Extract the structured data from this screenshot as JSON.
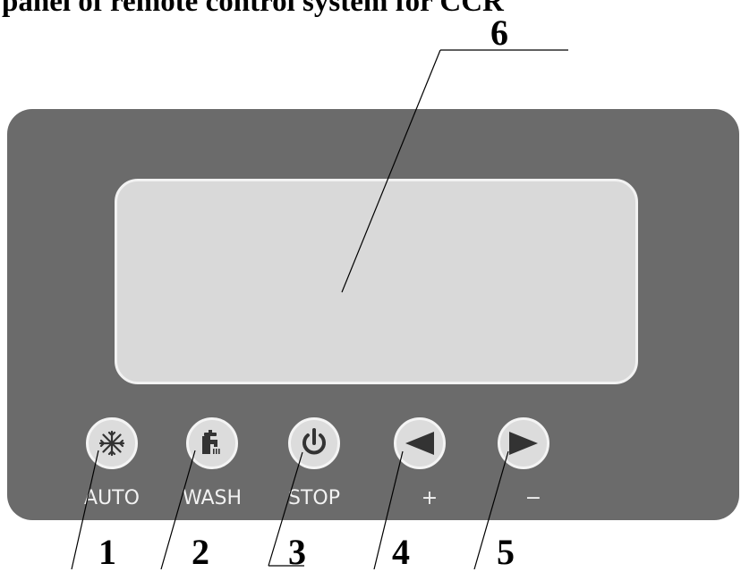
{
  "caption": "panel of remote control system for CCR",
  "buttons": [
    {
      "icon": "snowflake-icon",
      "label": "AUTO"
    },
    {
      "icon": "faucet-icon",
      "label": "WASH"
    },
    {
      "icon": "power-icon",
      "label": "STOP"
    },
    {
      "icon": "left-arrow-icon",
      "label": "+"
    },
    {
      "icon": "right-arrow-icon",
      "label": "−"
    }
  ],
  "callouts": [
    "1",
    "2",
    "3",
    "4",
    "5",
    "6"
  ]
}
